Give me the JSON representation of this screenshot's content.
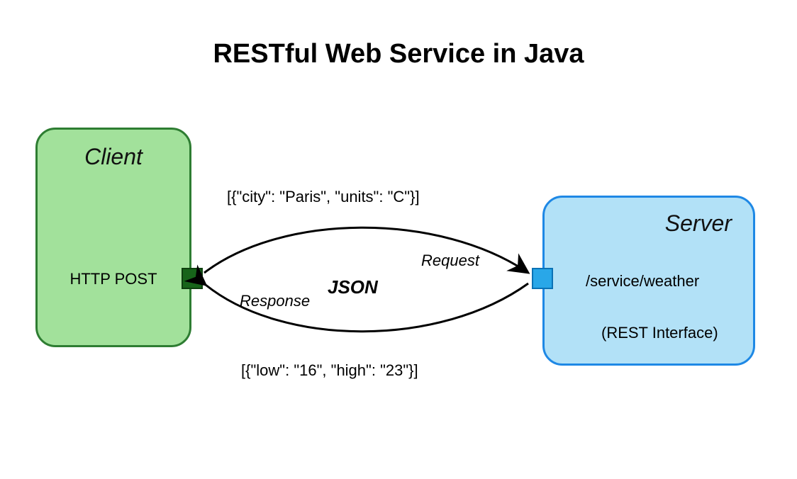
{
  "title": "RESTful Web Service in Java",
  "client": {
    "title": "Client",
    "method": "HTTP POST"
  },
  "server": {
    "title": "Server",
    "endpoint": "/service/weather",
    "interface": "(REST Interface)"
  },
  "protocol": "JSON",
  "request": {
    "label": "Request",
    "payload": "[{\"city\": \"Paris\", \"units\": \"C\"}]"
  },
  "response": {
    "label": "Response",
    "payload": "[{\"low\": \"16\", \"high\": \"23\"}]"
  }
}
